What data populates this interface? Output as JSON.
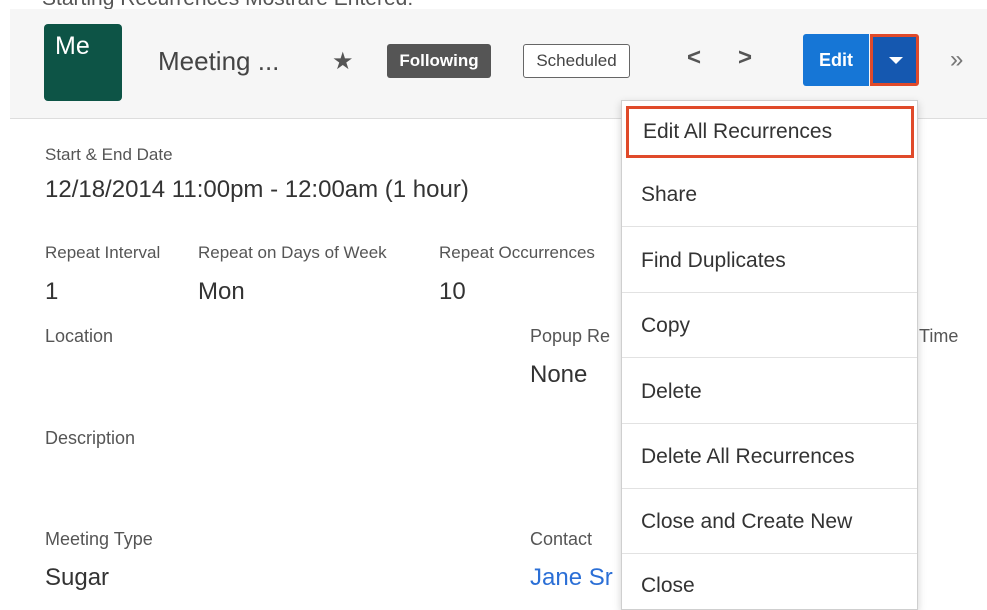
{
  "caption_partial": "Starting Recurrences Mostrare Entered:",
  "header": {
    "avatar_text": "Me",
    "record_title": "Meeting ...",
    "following_label": "Following",
    "status_label": "Scheduled",
    "prev_icon": "chevron-left-icon",
    "next_icon": "chevron-right-icon",
    "edit_label": "Edit",
    "more_icon": "double-chevron-right-icon",
    "colors": {
      "avatar": "#0d5446",
      "edit_button": "#1676d6",
      "highlight": "#e04a2a"
    }
  },
  "fields": {
    "start_end_label": "Start & End Date",
    "start_end_value": "12/18/2014 11:00pm - 12:00am (1 hour)",
    "repeat_interval_label": "Repeat Interval",
    "repeat_interval_value": "1",
    "repeat_days_label": "Repeat on Days of Week",
    "repeat_days_value": "Mon",
    "repeat_occurrences_label": "Repeat Occurrences",
    "repeat_occurrences_value": "10",
    "location_label": "Location",
    "popup_label": "Popup Re",
    "popup_value": "None",
    "time_label_fragment": "Time",
    "description_label": "Description",
    "meeting_type_label": "Meeting Type",
    "meeting_type_value": "Sugar",
    "contact_label": "Contact",
    "contact_value": "Jane Sr"
  },
  "menu": {
    "items": [
      {
        "label": "Edit All Recurrences",
        "highlighted": true
      },
      {
        "label": "Share"
      },
      {
        "label": "Find Duplicates"
      },
      {
        "label": "Copy"
      },
      {
        "label": "Delete"
      },
      {
        "label": "Delete All Recurrences"
      },
      {
        "label": "Close and Create New"
      },
      {
        "label": "Close"
      }
    ]
  }
}
